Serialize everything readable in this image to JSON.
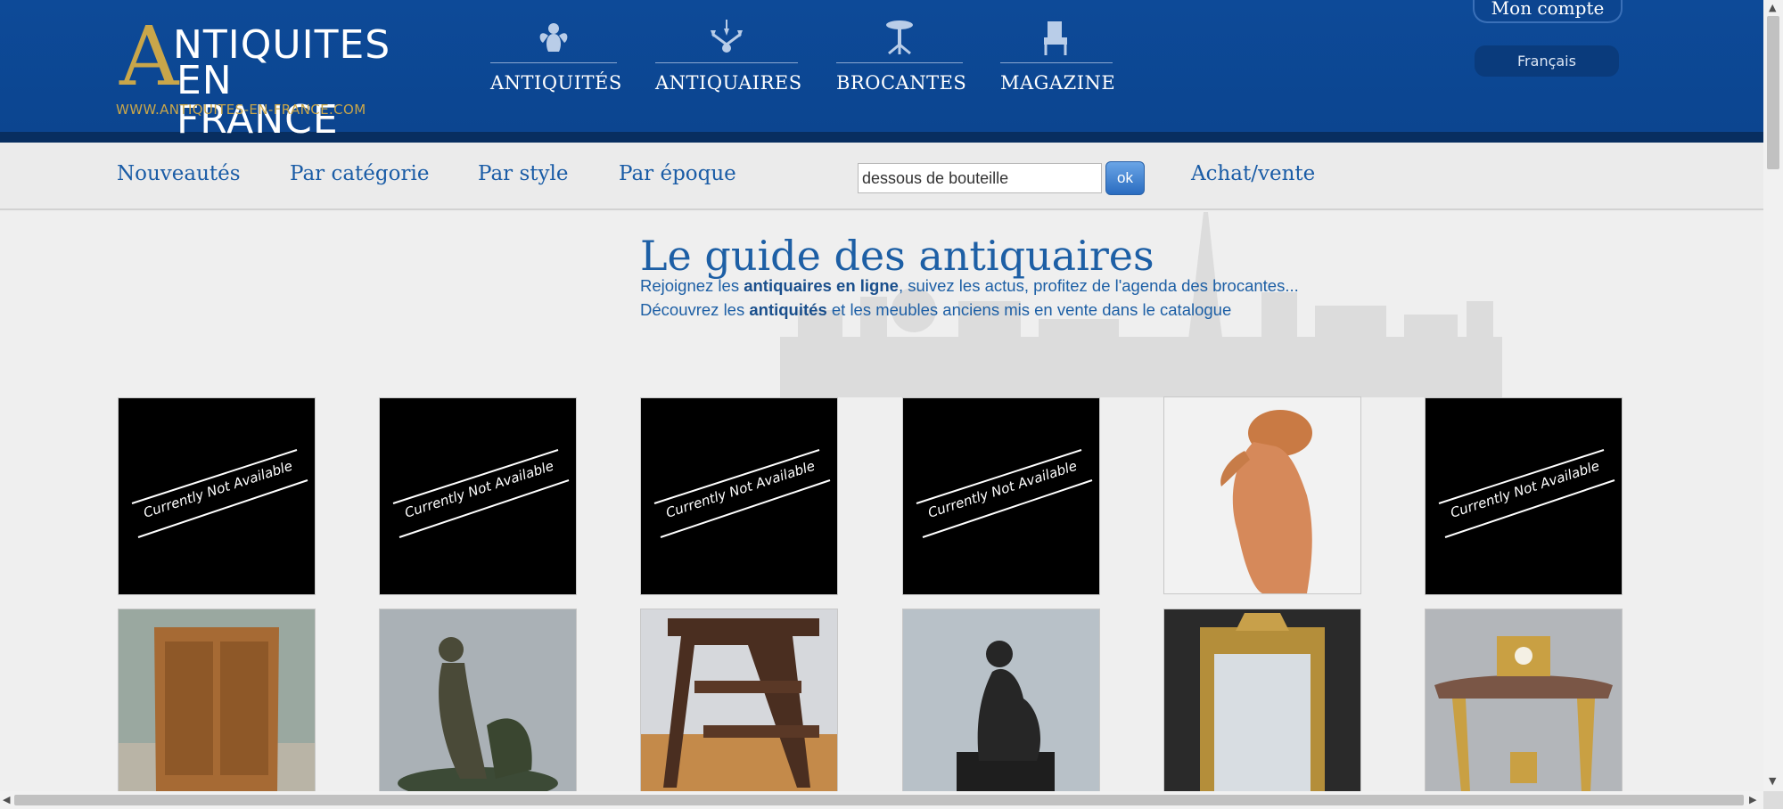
{
  "header": {
    "logo": {
      "big_letter": "A",
      "line1": "NTIQUITES",
      "line2": "EN FRANCE",
      "url": "WWW.ANTIQUITES-EN-FRANCE.COM"
    },
    "nav": [
      {
        "label": "ANTIQUITÉS",
        "icon": "cherub-icon"
      },
      {
        "label": "ANTIQUAIRES",
        "icon": "chandelier-icon"
      },
      {
        "label": "BROCANTES",
        "icon": "pedestal-table-icon"
      },
      {
        "label": "MAGAZINE",
        "icon": "armchair-icon"
      }
    ],
    "account_label": "Mon compte",
    "language": "Français"
  },
  "subnav": {
    "links": [
      "Nouveautés",
      "Par catégorie",
      "Par style",
      "Par époque"
    ],
    "search_value": "dessous de bouteille",
    "ok_label": "ok",
    "achat_vente": "Achat/vente"
  },
  "guide": {
    "title": "Le guide des antiquaires",
    "line1_pre": "Rejoignez les ",
    "line1_bold": "antiquaires en ligne",
    "line1_post": ", suivez les actus, profitez de l'agenda des brocantes...",
    "line2_pre": "Découvrez les ",
    "line2_bold": "antiquités",
    "line2_post": " et les meubles anciens mis en vente dans le catalogue"
  },
  "unavailable_text": "Currently Not Available",
  "colors": {
    "header_blue": "#0d4a98",
    "logo_gold": "#c9a64a",
    "link_blue": "#1d5fa5"
  }
}
